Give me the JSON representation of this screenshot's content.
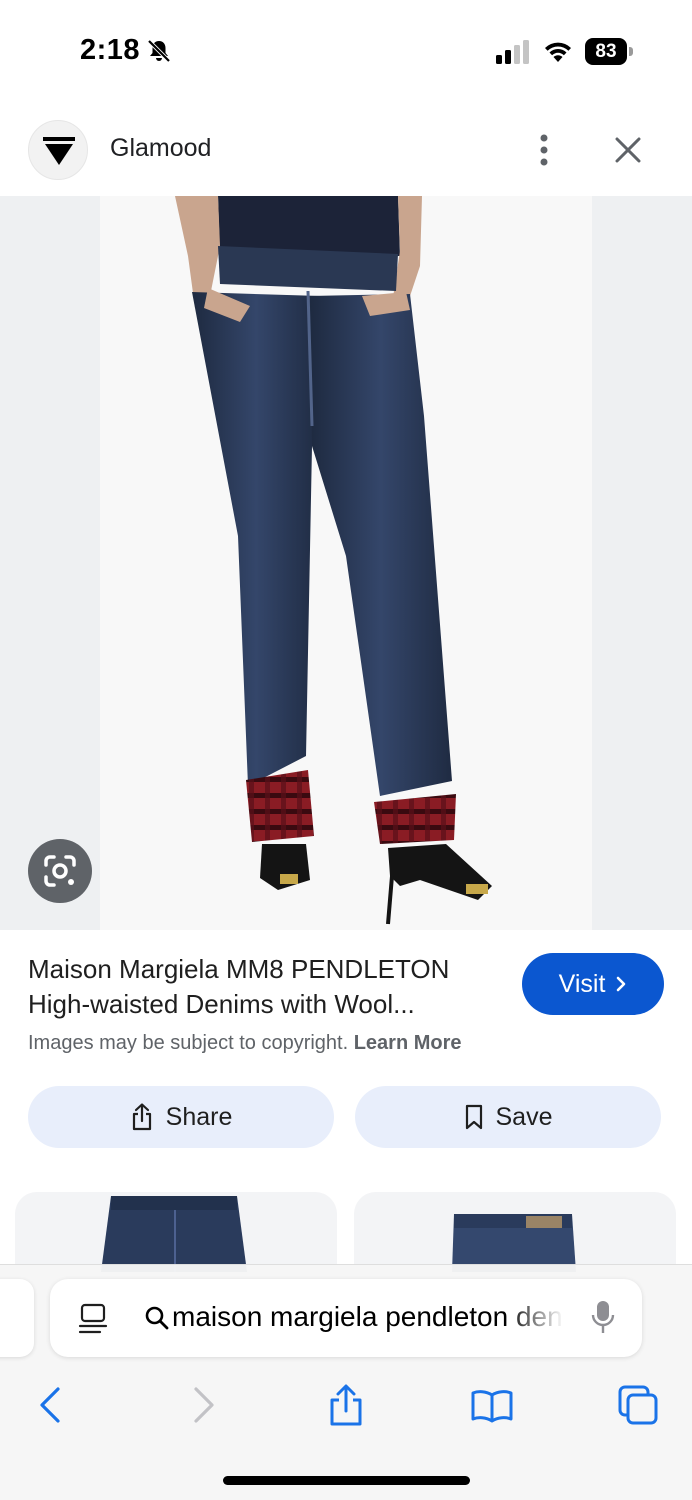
{
  "status_bar": {
    "time": "2:18",
    "battery_level": "83",
    "icons": [
      "bell-slash-icon",
      "cellular-signal-icon",
      "wifi-icon",
      "battery-icon"
    ]
  },
  "site_header": {
    "site_name": "Glamood",
    "logo_icon": "glamood-triangle-logo-icon",
    "more_icon": "more-vertical-icon",
    "close_icon": "close-icon"
  },
  "image": {
    "lens_icon": "google-lens-icon"
  },
  "result": {
    "title": "Maison Margiela MM8 PENDLETON High-waisted Denims with Wool...",
    "visit_label": "Visit",
    "copyright_text": "Images may be subject to copyright.",
    "learn_more_label": "Learn More"
  },
  "actions": {
    "share_label": "Share",
    "save_label": "Save"
  },
  "browser": {
    "address_text": "maison margiela pendleton denims",
    "toolbar_icons": [
      "back-chevron-icon",
      "forward-chevron-icon",
      "share-icon",
      "bookmarks-icon",
      "tabs-icon"
    ]
  },
  "colors": {
    "accent": "#0b57d0",
    "action_button_bg": "#e8eefb",
    "ios_blue": "#1a73e8",
    "denim": "#2b3a55",
    "plaid_red": "#8a1c24"
  }
}
